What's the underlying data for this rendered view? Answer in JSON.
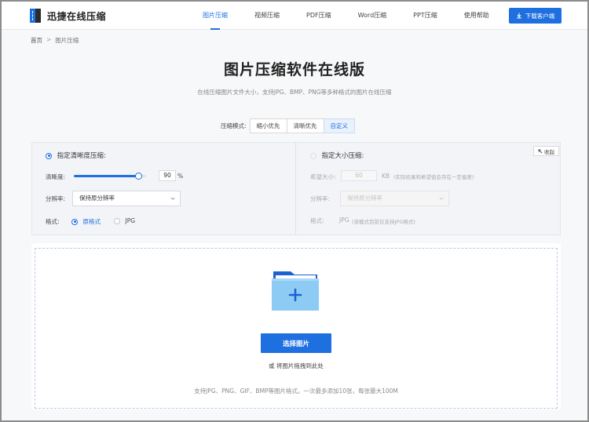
{
  "header": {
    "logo_text": "迅捷在线压缩",
    "nav": [
      {
        "label": "图片压缩",
        "active": true
      },
      {
        "label": "视频压缩",
        "active": false
      },
      {
        "label": "PDF压缩",
        "active": false
      },
      {
        "label": "Word压缩",
        "active": false
      },
      {
        "label": "PPT压缩",
        "active": false
      },
      {
        "label": "使用帮助",
        "active": false
      }
    ],
    "download_label": "下载客户端",
    "accent_color": "#1e6fe0"
  },
  "breadcrumb": {
    "home": "首页",
    "separator": ">",
    "current": "图片压缩"
  },
  "page": {
    "title": "图片压缩软件在线版",
    "subtitle": "在线压缩图片文件大小，支持JPG、BMP、PNG等多种格式的图片在线压缩"
  },
  "mode": {
    "label": "压缩模式:",
    "options": [
      "缩小优先",
      "清晰优先",
      "自定义"
    ],
    "selected": "自定义"
  },
  "settings": {
    "collapse_label": "收起",
    "clarity": {
      "title": "指定清晰度压缩:",
      "selected": true,
      "clarity_label": "清晰度:",
      "clarity_value": "90",
      "clarity_unit": "%",
      "clarity_level_percent": 90,
      "resolution_label": "分辨率:",
      "resolution_value": "保持原分辨率",
      "format_label": "格式:",
      "format_options": [
        "原格式",
        "JPG"
      ],
      "format_selected": "原格式"
    },
    "size": {
      "title": "指定大小压缩:",
      "selected": false,
      "size_label": "希望大小:",
      "size_value": "60",
      "size_unit": "KB",
      "size_note": "(实际结果和希望值会存在一定偏差)",
      "resolution_label": "分辨率:",
      "resolution_value": "保持原分辨率",
      "format_label": "格式:",
      "format_value": "JPG",
      "format_note": "(该模式目前仅支持JPG格式)"
    }
  },
  "upload": {
    "button_label": "选择图片",
    "drop_hint": "或 将图片拖拽到此处",
    "note": "支持JPG、PNG、GIF、BMP等图片格式。一次最多添加10张，每张最大100M"
  }
}
